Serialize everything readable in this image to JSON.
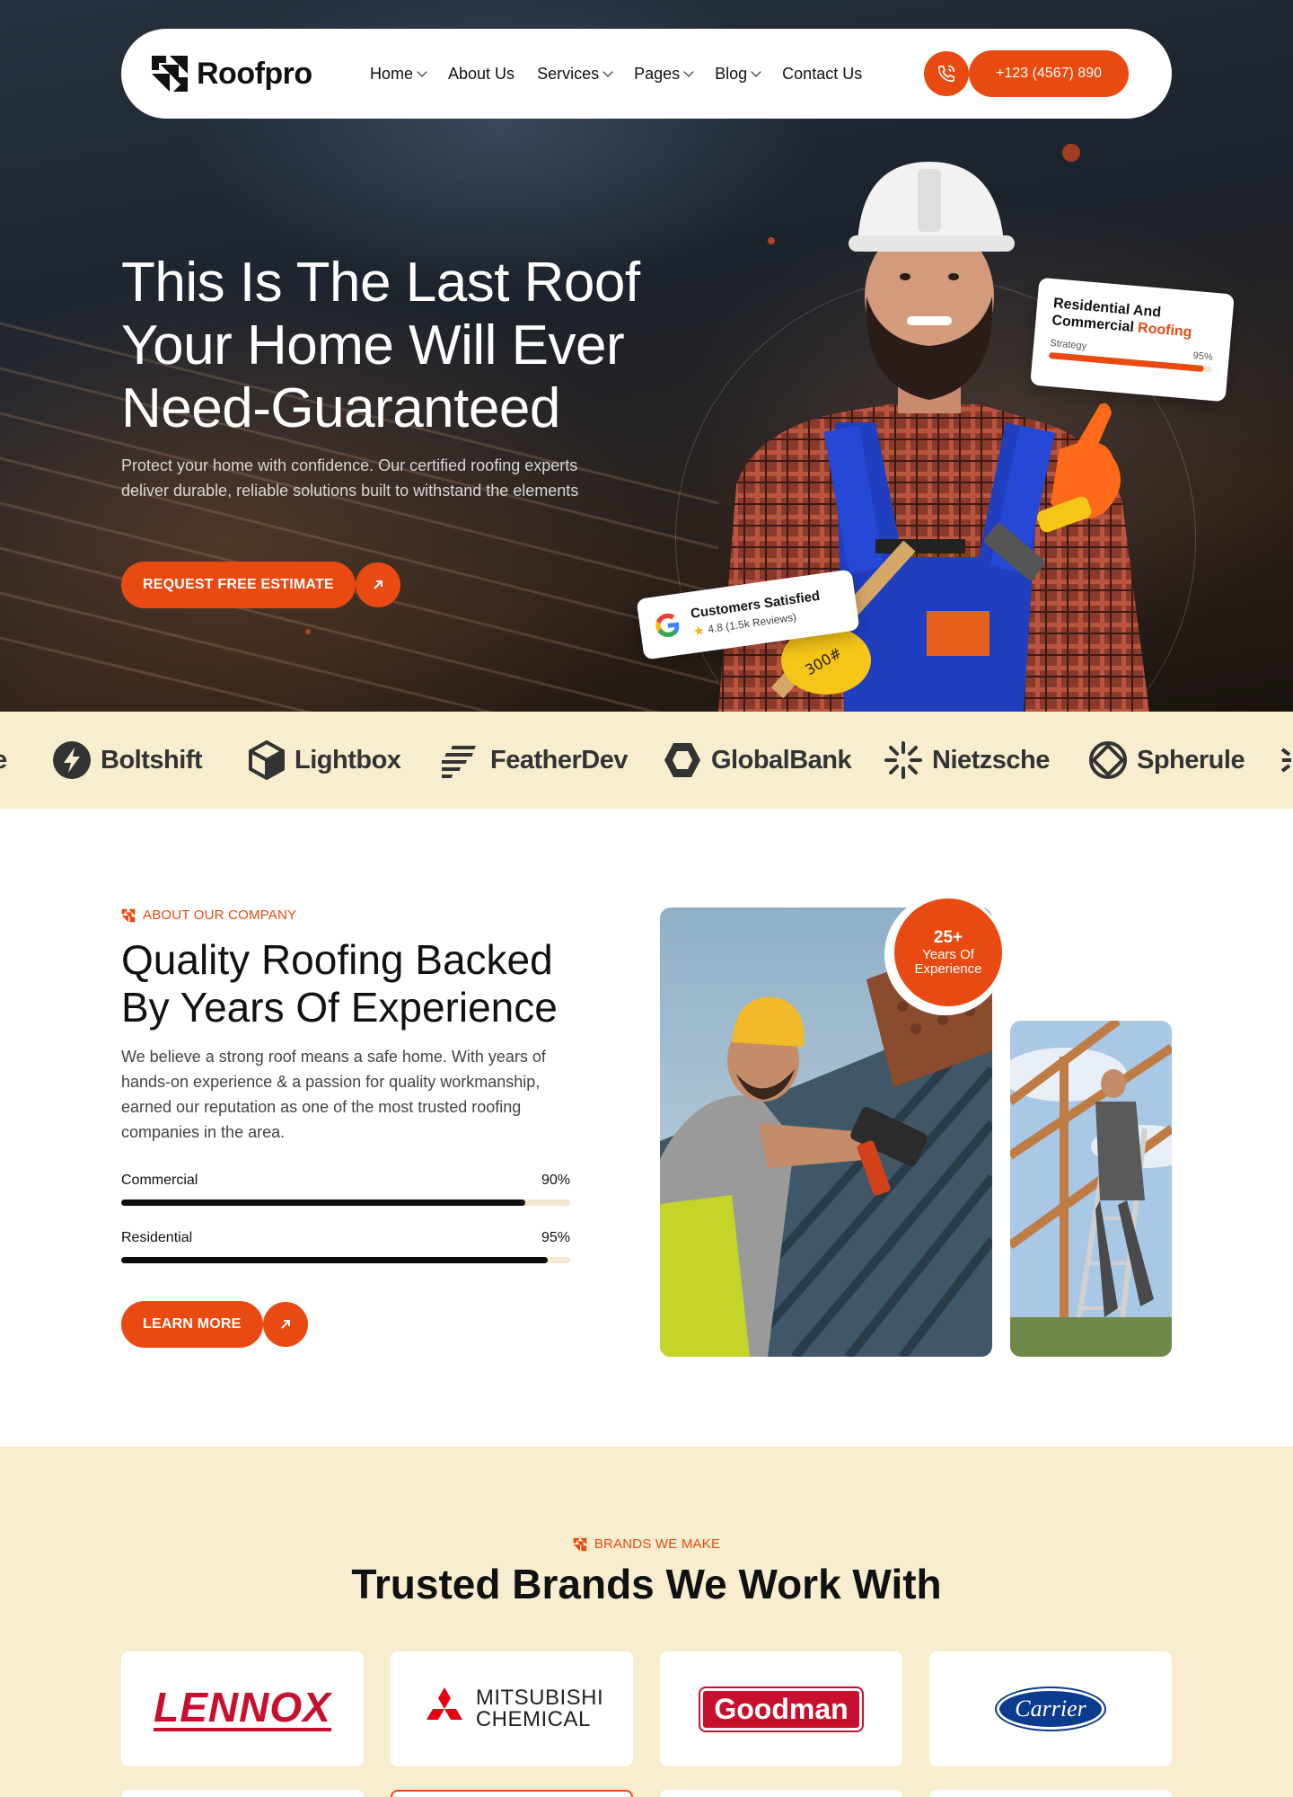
{
  "nav": {
    "logo": "Roofpro",
    "items": [
      {
        "label": "Home",
        "has_dropdown": true
      },
      {
        "label": "About Us",
        "has_dropdown": false
      },
      {
        "label": "Services",
        "has_dropdown": true
      },
      {
        "label": "Pages",
        "has_dropdown": true
      },
      {
        "label": "Blog",
        "has_dropdown": true
      },
      {
        "label": "Contact Us",
        "has_dropdown": false
      }
    ],
    "phone": "+123 (4567) 890"
  },
  "hero": {
    "title_line1": "This Is The Last Roof",
    "title_line2": "Your Home Will Ever",
    "title_line3": "Need-Guaranteed",
    "description": "Protect your home with confidence. Our certified roofing experts deliver durable, reliable solutions built to withstand the elements",
    "cta": "REQUEST FREE ESTIMATE",
    "card_service": {
      "title_part1": "Residential And",
      "title_part2": "Commercial",
      "title_accent": "Roofing",
      "label": "Strategy",
      "value_label": "95%",
      "value": 0.95
    },
    "card_reviews": {
      "title": "Customers Satisfied",
      "rating": "4.8 (1.5k Reviews)"
    },
    "worker_glove_text": "300#"
  },
  "logo_strip": [
    {
      "name": "Boltshift",
      "icon": "bolt-icon"
    },
    {
      "name": "Lightbox",
      "icon": "cube-icon"
    },
    {
      "name": "FeatherDev",
      "icon": "feather-lines-icon"
    },
    {
      "name": "GlobalBank",
      "icon": "hexagon-icon"
    },
    {
      "name": "Nietzsche",
      "icon": "starburst-icon"
    },
    {
      "name": "Spherule",
      "icon": "sphere-icon"
    }
  ],
  "about": {
    "eyebrow": "ABOUT OUR COMPANY",
    "title_line1": "Quality Roofing Backed",
    "title_line2": "By Years Of Experience",
    "description": "We believe a strong roof means a safe home. With years of hands-on experience & a passion for quality workmanship, earned our reputation as one of the most trusted roofing companies in the area.",
    "progress": [
      {
        "label": "Commercial",
        "value_label": "90%",
        "value": 0.9
      },
      {
        "label": "Residential",
        "value_label": "95%",
        "value": 0.95
      }
    ],
    "cta": "LEARN MORE",
    "badge_number": "25+",
    "badge_line1": "Years Of",
    "badge_line2": "Experience"
  },
  "brands": {
    "eyebrow": "BRANDS WE MAKE",
    "title": "Trusted Brands We Work With",
    "items": [
      {
        "name": "LENNOX"
      },
      {
        "name_line1": "MITSUBISHI",
        "name_line2": "CHEMICAL"
      },
      {
        "name": "Goodman"
      },
      {
        "name": "Carrier"
      }
    ]
  },
  "colors": {
    "accent": "#e84a11",
    "cream": "#f8edcf",
    "dark": "#111111"
  }
}
